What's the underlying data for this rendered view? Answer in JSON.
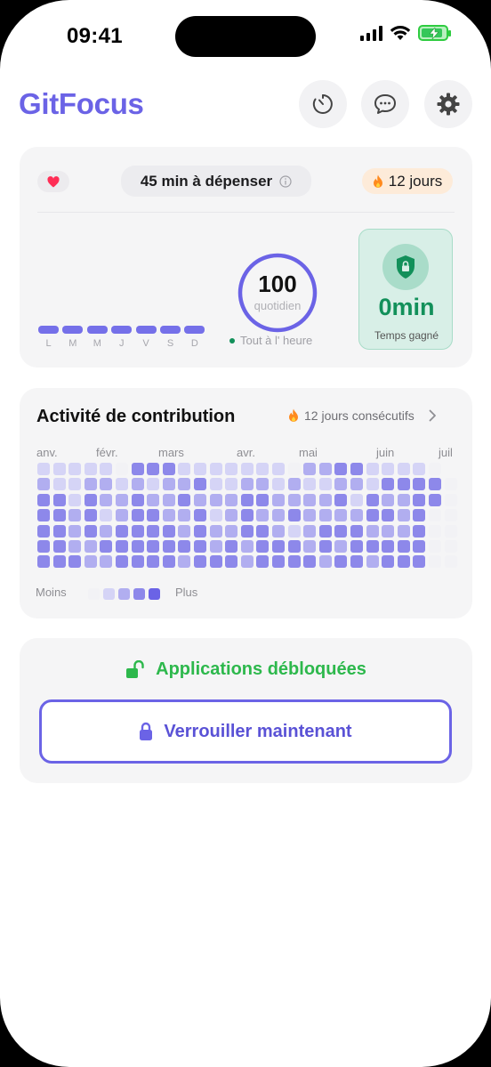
{
  "status_bar": {
    "time": "09:41",
    "battery_level": 0.9
  },
  "header": {
    "app_name": "GitFocus",
    "buttons": [
      "timer-icon",
      "chat-bubble-icon",
      "gear-icon"
    ]
  },
  "focus_card": {
    "budget_label": "45 min à dépenser",
    "streak_label": "12 jours",
    "weekday_labels": [
      "L",
      "M",
      "M",
      "J",
      "V",
      "S",
      "D"
    ],
    "score_value": "100",
    "score_caption": "quotidien",
    "status_text": "Tout à l' heure",
    "saved_value": "0min",
    "saved_caption": "Temps gagné",
    "colors": {
      "accent": "#6b63e6",
      "green": "#12905a",
      "saved_bg": "#d8efe7"
    }
  },
  "activity_card": {
    "title": "Activité de contribution",
    "streak_text": "12 jours consécutifs",
    "months": [
      "anv.",
      "févr.",
      "mars",
      "avr.",
      "mai",
      "juin",
      "juil"
    ],
    "legend_less": "Moins",
    "legend_more": "Plus",
    "levels": [
      [
        1,
        1,
        1,
        1,
        1,
        0,
        3,
        3,
        3,
        1,
        1,
        1,
        1,
        1,
        1,
        1,
        0,
        2,
        2,
        3,
        3,
        1,
        1,
        1,
        1,
        0
      ],
      [
        2,
        1,
        1,
        2,
        2,
        1,
        2,
        1,
        2,
        2,
        3,
        1,
        1,
        2,
        2,
        1,
        2,
        1,
        1,
        2,
        2,
        1,
        3,
        3,
        3,
        3,
        0
      ],
      [
        3,
        3,
        1,
        3,
        2,
        2,
        3,
        2,
        2,
        3,
        2,
        2,
        2,
        3,
        3,
        2,
        2,
        2,
        2,
        3,
        1,
        3,
        2,
        2,
        3,
        3,
        0
      ],
      [
        3,
        3,
        2,
        3,
        1,
        2,
        3,
        3,
        2,
        2,
        3,
        1,
        2,
        3,
        2,
        2,
        3,
        2,
        2,
        2,
        2,
        3,
        3,
        2,
        3,
        0,
        0
      ],
      [
        3,
        3,
        2,
        3,
        2,
        3,
        3,
        3,
        3,
        2,
        3,
        2,
        2,
        3,
        3,
        2,
        1,
        2,
        3,
        3,
        3,
        2,
        2,
        2,
        3,
        0,
        0
      ],
      [
        3,
        3,
        2,
        2,
        3,
        3,
        3,
        3,
        3,
        3,
        3,
        2,
        3,
        2,
        3,
        3,
        3,
        2,
        3,
        2,
        3,
        3,
        3,
        3,
        3,
        0,
        0
      ],
      [
        3,
        3,
        3,
        2,
        2,
        3,
        3,
        3,
        3,
        2,
        3,
        3,
        3,
        2,
        3,
        3,
        3,
        3,
        2,
        3,
        3,
        2,
        3,
        3,
        3,
        0,
        0
      ]
    ],
    "level_colors": [
      "#f2f2f5",
      "#d5d4f6",
      "#b1aef0",
      "#8d88ea",
      "#6b63e6"
    ]
  },
  "unlock_card": {
    "status_text": "Applications débloquées",
    "lock_button_label": "Verrouiller maintenant"
  }
}
